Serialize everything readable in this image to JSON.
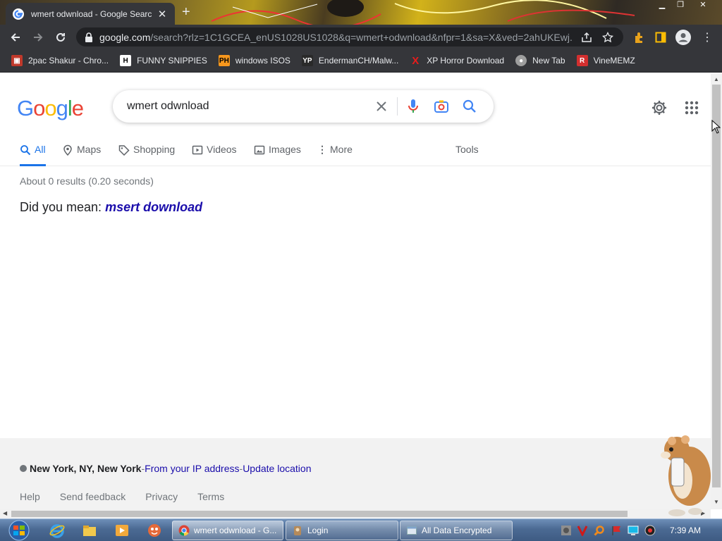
{
  "tab": {
    "title": "wmert odwnload - Google Search"
  },
  "toolbar": {
    "url_host": "google.com",
    "url_rest": "/search?rlz=1C1GCEA_enUS1028US1028&q=wmert+odwnload&nfpr=1&sa=X&ved=2ahUKEwj..."
  },
  "bookmarks": [
    {
      "label": "2pac Shakur - Chro...",
      "icon": "bookmark-icon",
      "color": "#e8eaed"
    },
    {
      "label": "FUNNY SNIPPIES",
      "icon": "h-icon",
      "color": "#ffffff"
    },
    {
      "label": "windows ISOS",
      "icon": "ph-icon",
      "color": "#f7971d"
    },
    {
      "label": "EndermanCH/Malw...",
      "icon": "yp-icon",
      "color": "#2a2a2a"
    },
    {
      "label": "XP Horror Download",
      "icon": "x-icon",
      "color": "#e81c1c"
    },
    {
      "label": "New Tab",
      "icon": "globe-icon",
      "color": "#9e9e9e"
    },
    {
      "label": "VineMEMZ",
      "icon": "r-icon",
      "color": "#d32f2f"
    }
  ],
  "search": {
    "query": "wmert odwnload"
  },
  "nav_tabs": [
    "All",
    "Maps",
    "Shopping",
    "Videos",
    "Images",
    "More",
    "Tools"
  ],
  "results": {
    "stats": "About 0 results (0.20 seconds)",
    "did_you_mean_label": "Did you mean:",
    "suggestion": "msert download"
  },
  "footer": {
    "location": "New York, NY, New York",
    "separator": " - ",
    "ip_link": "From your IP address",
    "update_link": "Update location",
    "links": [
      "Help",
      "Send feedback",
      "Privacy",
      "Terms"
    ]
  },
  "taskbar": {
    "buttons": [
      "wmert odwnload - G...",
      "Login",
      "All Data Encrypted"
    ],
    "clock": "7:39 AM"
  },
  "colors": {
    "link": "#1a0dab",
    "active_tab": "#1a73e8",
    "chrome_dark": "#35363a"
  }
}
